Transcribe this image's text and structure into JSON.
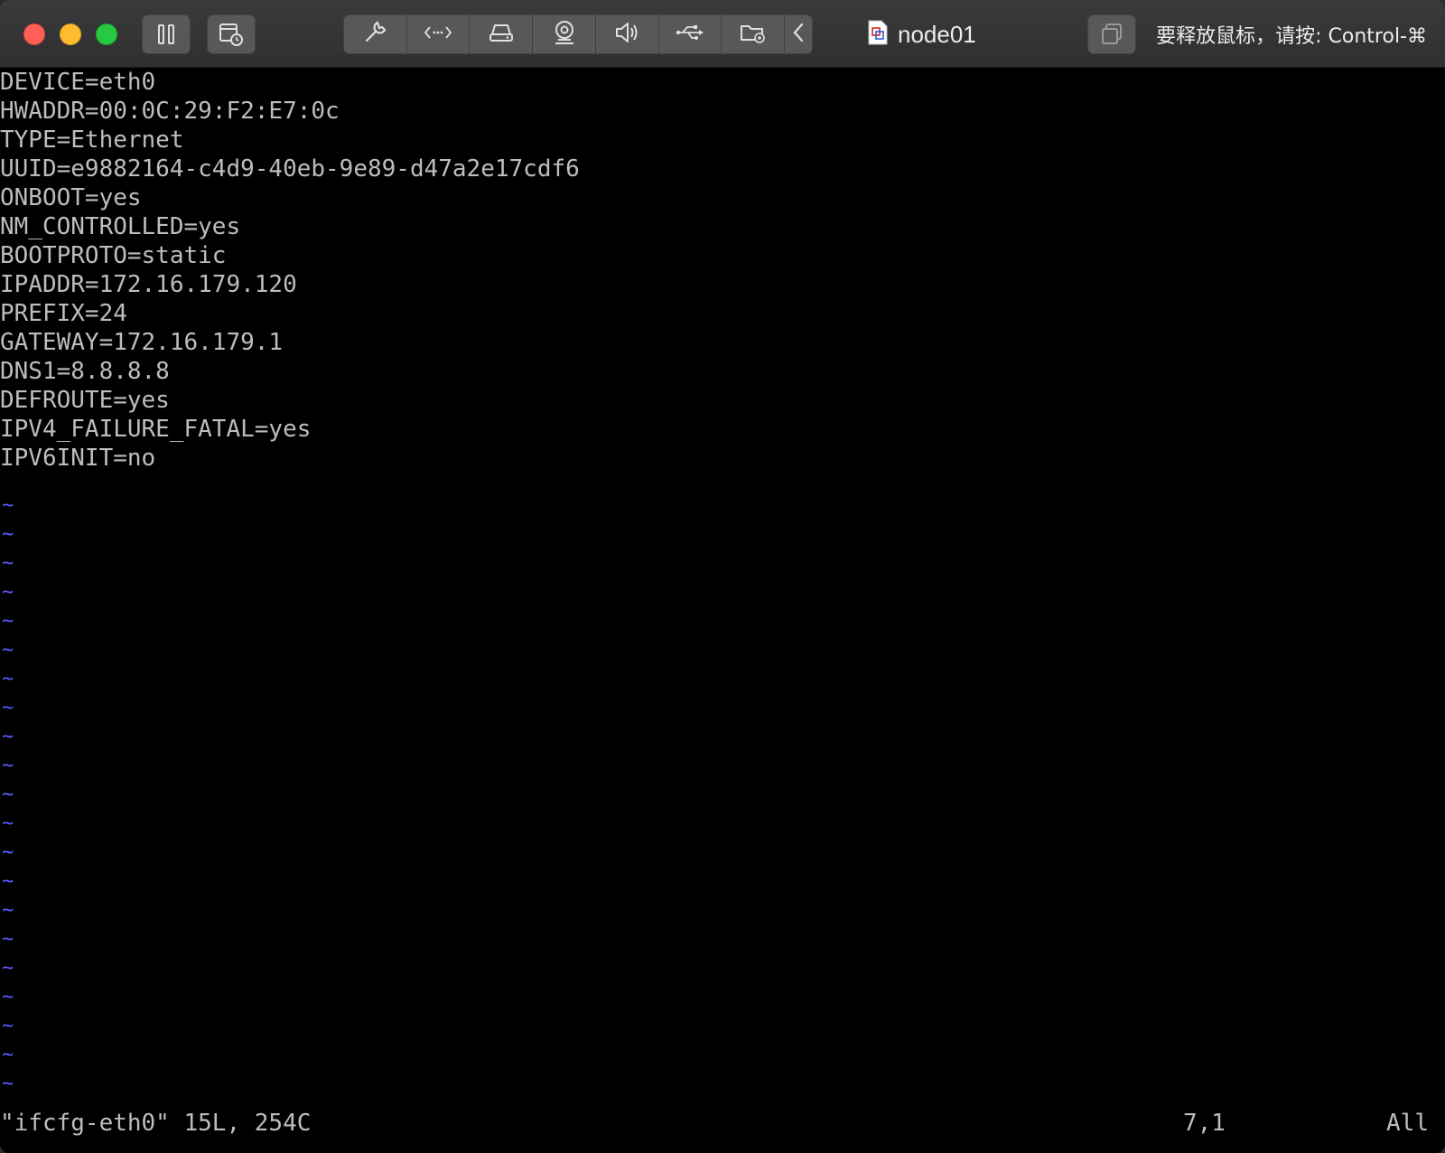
{
  "window": {
    "title": "node01",
    "release_hint": "要释放鼠标，请按: Control-⌘"
  },
  "toolbar": {
    "buttons": [
      {
        "name": "pause-button",
        "icon": "pause-icon"
      },
      {
        "name": "snapshot-button",
        "icon": "snapshot-icon"
      },
      {
        "name": "settings-button",
        "icon": "wrench-icon"
      },
      {
        "name": "network-button",
        "icon": "network-arrows-icon"
      },
      {
        "name": "hard-disk-button",
        "icon": "hard-disk-icon"
      },
      {
        "name": "camera-button",
        "icon": "webcam-icon"
      },
      {
        "name": "sound-button",
        "icon": "speaker-icon"
      },
      {
        "name": "usb-button",
        "icon": "usb-icon"
      },
      {
        "name": "shared-folder-button",
        "icon": "shared-folder-icon"
      },
      {
        "name": "collapse-toolbar-button",
        "icon": "chevron-left-icon"
      },
      {
        "name": "unity-button",
        "icon": "unity-windows-icon"
      }
    ]
  },
  "editor": {
    "lines": [
      "DEVICE=eth0",
      "HWADDR=00:0C:29:F2:E7:0c",
      "TYPE=Ethernet",
      "UUID=e9882164-c4d9-40eb-9e89-d47a2e17cdf6",
      "ONBOOT=yes",
      "NM_CONTROLLED=yes",
      "BOOTPROTO=static",
      "IPADDR=172.16.179.120",
      "PREFIX=24",
      "GATEWAY=172.16.179.1",
      "DNS1=8.8.8.8",
      "DEFROUTE=yes",
      "IPV4_FAILURE_FATAL=yes",
      "IPV6INIT=no"
    ],
    "empty_line_marker": "~",
    "status": {
      "file_info": "\"ifcfg-eth0\" 15L, 254C",
      "cursor_position": "7,1",
      "scroll_position": "All"
    }
  },
  "colors": {
    "text": "#bdbdbd",
    "tilde": "#5a5aff",
    "background": "#000000"
  }
}
